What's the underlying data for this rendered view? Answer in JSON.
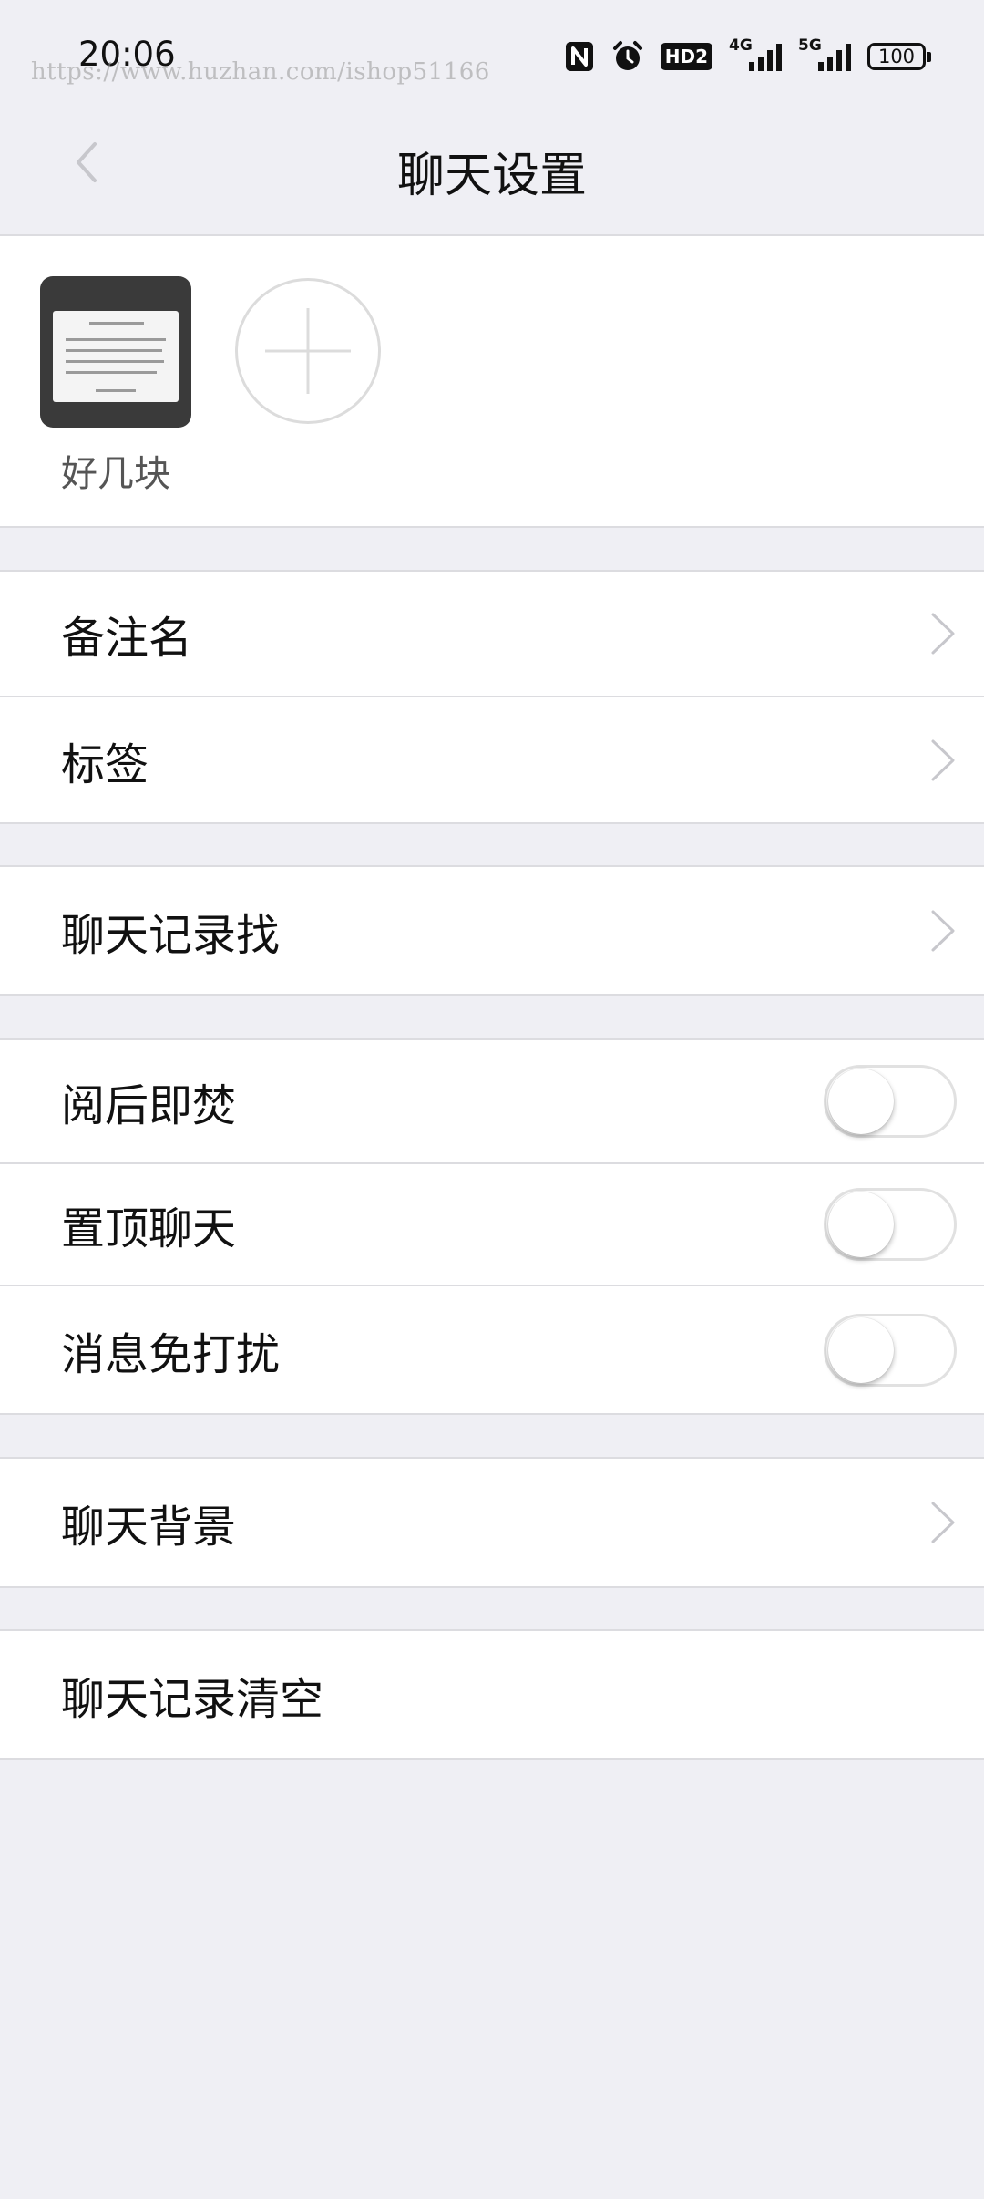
{
  "status_bar": {
    "time": "20:06",
    "watermark": "https://www.huzhan.com/ishop51166",
    "hd_label": "HD2",
    "net_4g": "4G",
    "net_5g": "5G",
    "battery": "100"
  },
  "nav": {
    "title": "聊天设置"
  },
  "members": {
    "items": [
      {
        "name": "好几块"
      }
    ]
  },
  "section1": {
    "remark_label": "备注名",
    "tags_label": "标签"
  },
  "section2": {
    "search_history_label": "聊天记录找"
  },
  "section3": {
    "burn_after_read_label": "阅后即焚",
    "burn_after_read_on": false,
    "pin_chat_label": "置顶聊天",
    "pin_chat_on": false,
    "mute_label": "消息免打扰",
    "mute_on": false
  },
  "section4": {
    "background_label": "聊天背景"
  },
  "section5": {
    "clear_history_label": "聊天记录清空"
  },
  "colors": {
    "page_bg": "#efeff4",
    "card_bg": "#ffffff",
    "divider": "#dcdce0",
    "chevron": "#c7c7cc"
  }
}
